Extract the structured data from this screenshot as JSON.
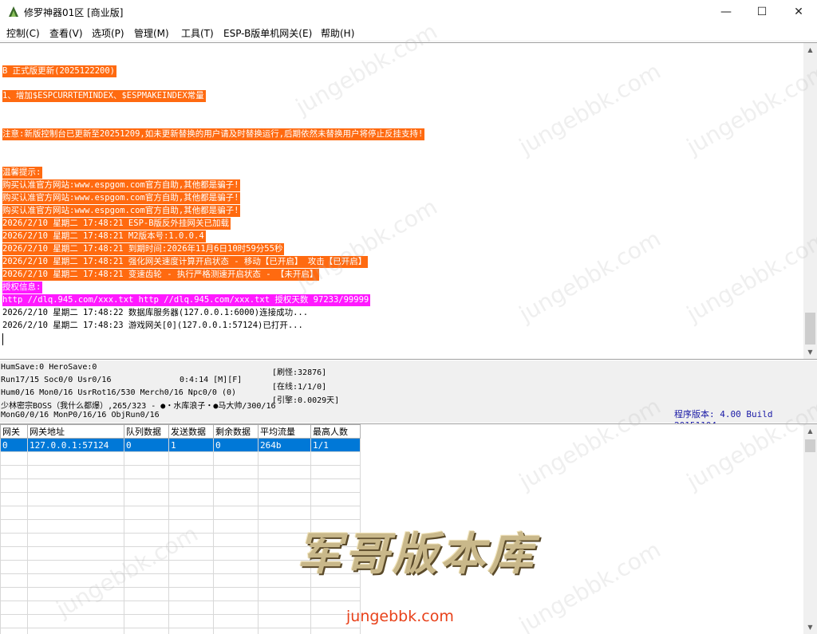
{
  "window": {
    "title": "修罗神器01区 [商业版]",
    "min_glyph": "—",
    "max_glyph": "☐",
    "close_glyph": "✕"
  },
  "menu": [
    "控制(C)",
    "查看(V)",
    "选项(P)",
    "管理(M)",
    "工具(T)",
    "ESP-B版单机网关(E)",
    "帮助(H)"
  ],
  "log": {
    "lines": [
      {
        "text": "B 正式版更新(2025122200)",
        "style": "orange"
      },
      {
        "text": "1、增加$ESPCURRTEMINDEX、$ESPMAKEINDEX常量",
        "style": "orange"
      },
      {
        "text": "注意:新版控制台已更新至20251209,如未更新替换的用户请及时替换运行,后期依然未替换用户将停止反挂支持!",
        "style": "orange"
      },
      {
        "text": "温馨提示:",
        "style": "orange"
      },
      {
        "text": "购买认准官方网站:www.espgom.com官方自助,其他都是骗子!",
        "style": "orange"
      },
      {
        "text": "购买认准官方网站:www.espgom.com官方自助,其他都是骗子!",
        "style": "orange"
      },
      {
        "text": "购买认准官方网站:www.espgom.com官方自助,其他都是骗子!",
        "style": "orange"
      },
      {
        "text": "2026/2/10 星期二 17:48:21 ESP-B版反外挂网关已加载",
        "style": "orange"
      },
      {
        "text": "2026/2/10 星期二 17:48:21 M2版本号:1.0.0.4",
        "style": "orange"
      },
      {
        "text": "2026/2/10 星期二 17:48:21 到期时间:2026年11月6日10时59分55秒",
        "style": "orange"
      },
      {
        "text": "2026/2/10 星期二 17:48:21 强化网关速度计算开启状态 - 移动【已开启】 攻击【已开启】",
        "style": "orange"
      },
      {
        "text": "2026/2/10 星期二 17:48:21 变速齿轮 - 执行严格测速开启状态 - 【未开启】",
        "style": "orange"
      },
      {
        "text": "授权信息:",
        "style": "magenta"
      },
      {
        "text": "http //dlq.945.com/xxx.txt http //dlq.945.com/xxx.txt 授权天数 97233/99999",
        "style": "magenta"
      },
      {
        "text": "2026/2/10 星期二 17:48:22 数据库服务器(127.0.0.1:6000)连接成功...",
        "style": "plain"
      },
      {
        "text": "2026/2/10 星期二 17:48:23 游戏网关[0](127.0.0.1:57124)已打开...",
        "style": "plain"
      }
    ]
  },
  "status": {
    "l1": "HumSave:0 HeroSave:0",
    "l2": "Run17/15 Soc0/0 Usr0/16",
    "l2b": "0:4:14 [M][F]",
    "l3": "Hum0/16 Mon0/16 UsrRot16/530 Merch0/16 Npc0/0 (0)",
    "l4": "少林密宗BOSS（我什么都爆）,265/323 - ●・水库浪子・●马大帅/300/16",
    "l5": "MonG0/0/16 MonP0/16/16 ObjRun0/16",
    "r1": "[刷怪:32876]",
    "r2": "[在线:1/1/0]",
    "r3": "[引擎:0.0029天]",
    "version": "程序版本: 4.00 Build 20151104"
  },
  "table": {
    "headers": [
      "网关",
      "网关地址",
      "队列数据",
      "发送数据",
      "剩余数据",
      "平均流量",
      "最高人数"
    ],
    "rows": [
      [
        "0",
        "127.0.0.1:57124",
        "0",
        "1",
        "0",
        "264b",
        "1/1"
      ]
    ],
    "empty_rows": 14
  },
  "watermark": {
    "text": "jungebbk.com",
    "logo": "军哥版本库",
    "url": "jungebbk.com"
  }
}
